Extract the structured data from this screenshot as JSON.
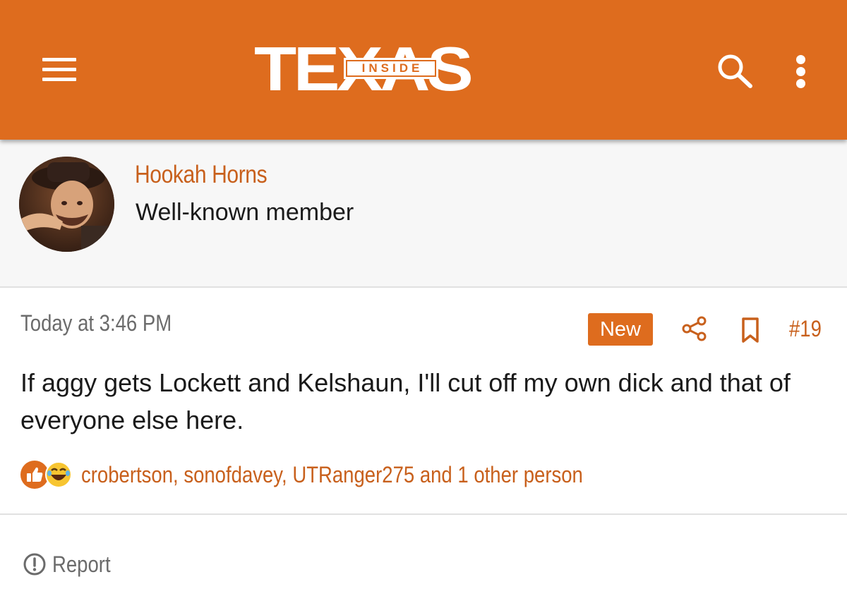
{
  "header": {
    "logo_main": "TEXAS",
    "logo_badge": "INSIDE",
    "menu_icon": "hamburger-menu-icon",
    "search_icon": "search-icon",
    "more_icon": "vertical-dots-icon",
    "background_color": "#de6c1e"
  },
  "author": {
    "name": "Hookah Horns",
    "title": "Well-known member"
  },
  "post": {
    "timestamp": "Today at 3:46 PM",
    "new_badge": "New",
    "post_number": "#19",
    "body": "If aggy gets Lockett and Kelshaun, I'll cut off my own dick and that of everyone else here.",
    "share_icon": "share-icon",
    "bookmark_icon": "bookmark-icon"
  },
  "reactions": {
    "icons": [
      "like-icon",
      "laughing-emoji-icon"
    ],
    "names": "crobertson, sonofdavey, UTRanger275 and 1 other person"
  },
  "footer": {
    "report_label": "Report",
    "report_icon": "alert-circle-icon"
  },
  "colors": {
    "accent": "#de6c1e",
    "link": "#c8601c",
    "muted_text": "#6b6b6b",
    "body_text": "#1a1a1a"
  }
}
